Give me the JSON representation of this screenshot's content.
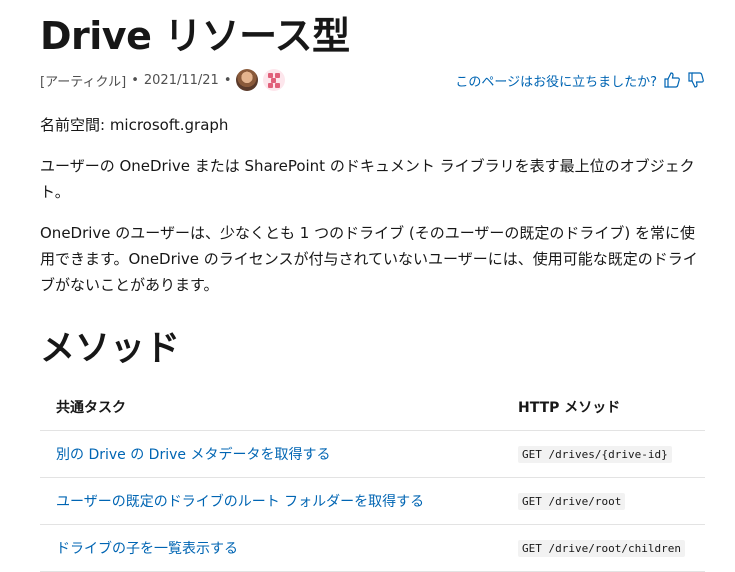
{
  "header": {
    "title": "Drive リソース型"
  },
  "meta": {
    "article_label": "[アーティクル]",
    "separator": "•",
    "date": "2021/11/21",
    "feedback_question": "このページはお役に立ちましたか?"
  },
  "content": {
    "namespace": "名前空間: microsoft.graph",
    "para1": "ユーザーの OneDrive または SharePoint のドキュメント ライブラリを表す最上位のオブジェクト。",
    "para2": "OneDrive のユーザーは、少なくとも 1 つのドライブ (そのユーザーの既定のドライブ) を常に使用できます。OneDrive のライセンスが付与されていないユーザーには、使用可能な既定のドライブがないことがあります。"
  },
  "methods": {
    "heading": "メソッド",
    "columns": [
      "共通タスク",
      "HTTP メソッド"
    ],
    "rows": [
      {
        "task": "別の Drive の Drive メタデータを取得する",
        "http": "GET /drives/{drive-id}"
      },
      {
        "task": "ユーザーの既定のドライブのルート フォルダーを取得する",
        "http": "GET /drive/root"
      },
      {
        "task": "ドライブの子を一覧表示する",
        "http": "GET /drive/root/children"
      }
    ]
  },
  "icons": {
    "like": "thumbs-up-icon",
    "dislike": "thumbs-down-icon"
  },
  "colors": {
    "link": "#0065b3",
    "text": "#171717",
    "muted": "#505050"
  }
}
